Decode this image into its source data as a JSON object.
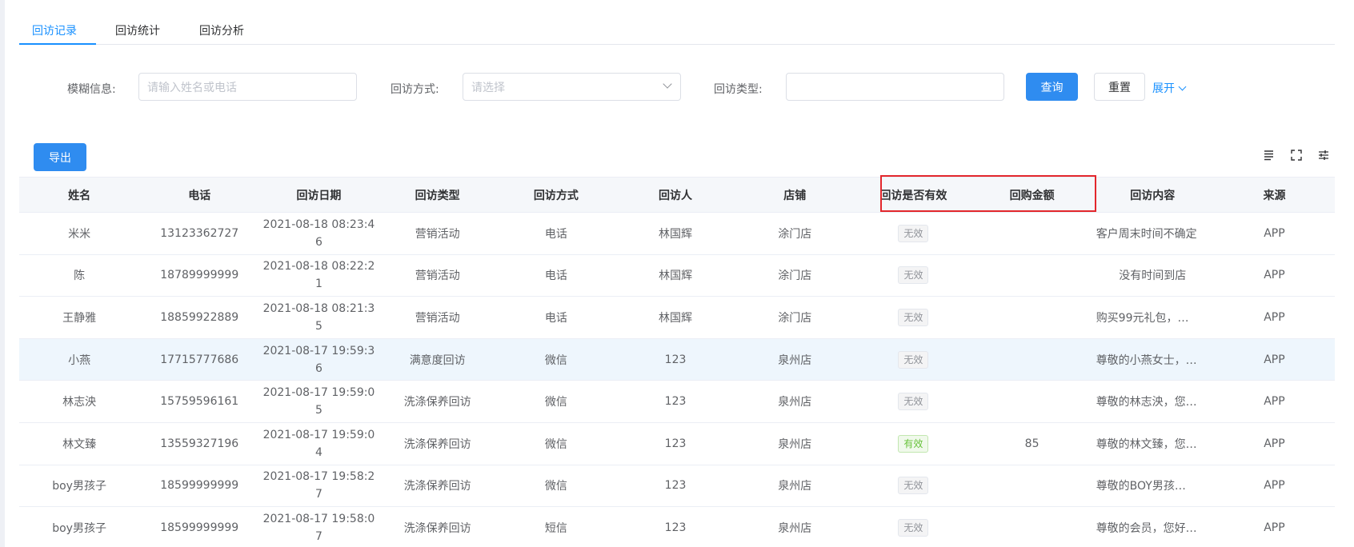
{
  "tabs": [
    {
      "label": "回访记录",
      "active": true
    },
    {
      "label": "回访统计",
      "active": false
    },
    {
      "label": "回访分析",
      "active": false
    }
  ],
  "filters": {
    "fuzzy_label": "模糊信息:",
    "fuzzy_placeholder": "请输入姓名或电话",
    "method_label": "回访方式:",
    "method_placeholder": "请选择",
    "type_label": "回访类型:",
    "type_value": ""
  },
  "buttons": {
    "query": "查询",
    "reset": "重置",
    "expand": "展开",
    "export": "导出"
  },
  "table": {
    "headers": [
      "姓名",
      "电话",
      "回访日期",
      "回访类型",
      "回访方式",
      "回访人",
      "店铺",
      "回访是否有效",
      "回购金额",
      "回访内容",
      "来源"
    ],
    "rows": [
      {
        "name": "米米",
        "phone": "13123362727",
        "date": "2021-08-18 08:23:46",
        "type": "营销活动",
        "method": "电话",
        "visitor": "林国辉",
        "store": "涂门店",
        "valid": "无效",
        "amount": "",
        "content": "客户周末时间不确定",
        "source": "APP"
      },
      {
        "name": "陈",
        "phone": "18789999999",
        "date": "2021-08-18 08:22:21",
        "type": "营销活动",
        "method": "电话",
        "visitor": "林国辉",
        "store": "涂门店",
        "valid": "无效",
        "amount": "",
        "content": "没有时间到店",
        "source": "APP"
      },
      {
        "name": "王静雅",
        "phone": "18859922889",
        "date": "2021-08-18 08:21:35",
        "type": "营销活动",
        "method": "电话",
        "visitor": "林国辉",
        "store": "涂门店",
        "valid": "无效",
        "amount": "",
        "content": "购买99元礼包，…",
        "source": "APP"
      },
      {
        "name": "小燕",
        "phone": "17715777686",
        "date": "2021-08-17 19:59:36",
        "type": "满意度回访",
        "method": "微信",
        "visitor": "123",
        "store": "泉州店",
        "valid": "无效",
        "amount": "",
        "content": "尊敬的小燕女士，…",
        "source": "APP"
      },
      {
        "name": "林志泱",
        "phone": "15759596161",
        "date": "2021-08-17 19:59:05",
        "type": "洗涤保养回访",
        "method": "微信",
        "visitor": "123",
        "store": "泉州店",
        "valid": "无效",
        "amount": "",
        "content": "尊敬的林志泱，您…",
        "source": "APP"
      },
      {
        "name": "林文臻",
        "phone": "13559327196",
        "date": "2021-08-17 19:59:04",
        "type": "洗涤保养回访",
        "method": "微信",
        "visitor": "123",
        "store": "泉州店",
        "valid": "有效",
        "amount": "85",
        "content": "尊敬的林文臻，您…",
        "source": "APP"
      },
      {
        "name": "boy男孩子",
        "phone": "18599999999",
        "date": "2021-08-17 19:58:27",
        "type": "洗涤保养回访",
        "method": "微信",
        "visitor": "123",
        "store": "泉州店",
        "valid": "无效",
        "amount": "",
        "content": "尊敬的BOY男孩…",
        "source": "APP"
      },
      {
        "name": "boy男孩子",
        "phone": "18599999999",
        "date": "2021-08-17 19:58:07",
        "type": "洗涤保养回访",
        "method": "短信",
        "visitor": "123",
        "store": "泉州店",
        "valid": "无效",
        "amount": "",
        "content": "尊敬的会员，您好…",
        "source": "APP"
      }
    ]
  },
  "colors": {
    "primary": "#2f8cf0",
    "highlight_box": "#e3272c",
    "valid_tag": "#67c23a",
    "invalid_tag": "#909399"
  },
  "icons": [
    "density-icon",
    "fullscreen-icon",
    "column-settings-icon"
  ]
}
